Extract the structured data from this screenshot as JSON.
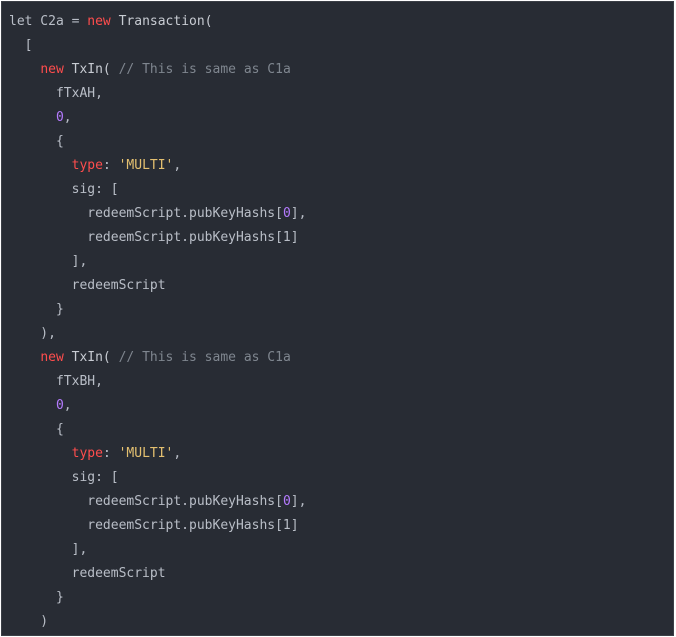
{
  "code": {
    "lines": [
      [
        {
          "t": "let C2a = ",
          "c": "ident"
        },
        {
          "t": "new",
          "c": "kw"
        },
        {
          "t": " Transaction(",
          "c": "fn"
        }
      ],
      [
        {
          "t": "  [",
          "c": "punc"
        }
      ],
      [
        {
          "t": "    ",
          "c": "punc"
        },
        {
          "t": "new",
          "c": "kw"
        },
        {
          "t": " TxIn( ",
          "c": "fn"
        },
        {
          "t": "// This is same as C1a",
          "c": "cm"
        }
      ],
      [
        {
          "t": "      fTxAH,",
          "c": "ident"
        }
      ],
      [
        {
          "t": "      ",
          "c": "punc"
        },
        {
          "t": "0",
          "c": "num"
        },
        {
          "t": ",",
          "c": "punc"
        }
      ],
      [
        {
          "t": "      {",
          "c": "punc"
        }
      ],
      [
        {
          "t": "        ",
          "c": "punc"
        },
        {
          "t": "type",
          "c": "prop"
        },
        {
          "t": ": ",
          "c": "punc"
        },
        {
          "t": "'MULTI'",
          "c": "str"
        },
        {
          "t": ",",
          "c": "punc"
        }
      ],
      [
        {
          "t": "        sig: [",
          "c": "ident"
        }
      ],
      [
        {
          "t": "          redeemScript.pubKeyHashs[",
          "c": "ident"
        },
        {
          "t": "0",
          "c": "num"
        },
        {
          "t": "],",
          "c": "ident"
        }
      ],
      [
        {
          "t": "          redeemScript.pubKeyHashs[1]",
          "c": "ident"
        }
      ],
      [
        {
          "t": "        ],",
          "c": "punc"
        }
      ],
      [
        {
          "t": "        redeemScript",
          "c": "ident"
        }
      ],
      [
        {
          "t": "      }",
          "c": "punc"
        }
      ],
      [
        {
          "t": "    ),",
          "c": "punc"
        }
      ],
      [
        {
          "t": "    ",
          "c": "punc"
        },
        {
          "t": "new",
          "c": "kw"
        },
        {
          "t": " TxIn( ",
          "c": "fn"
        },
        {
          "t": "// This is same as C1a",
          "c": "cm"
        }
      ],
      [
        {
          "t": "      fTxBH,",
          "c": "ident"
        }
      ],
      [
        {
          "t": "      ",
          "c": "punc"
        },
        {
          "t": "0",
          "c": "num"
        },
        {
          "t": ",",
          "c": "punc"
        }
      ],
      [
        {
          "t": "      {",
          "c": "punc"
        }
      ],
      [
        {
          "t": "        ",
          "c": "punc"
        },
        {
          "t": "type",
          "c": "prop"
        },
        {
          "t": ": ",
          "c": "punc"
        },
        {
          "t": "'MULTI'",
          "c": "str"
        },
        {
          "t": ",",
          "c": "punc"
        }
      ],
      [
        {
          "t": "        sig: [",
          "c": "ident"
        }
      ],
      [
        {
          "t": "          redeemScript.pubKeyHashs[",
          "c": "ident"
        },
        {
          "t": "0",
          "c": "num"
        },
        {
          "t": "],",
          "c": "ident"
        }
      ],
      [
        {
          "t": "          redeemScript.pubKeyHashs[1]",
          "c": "ident"
        }
      ],
      [
        {
          "t": "        ],",
          "c": "punc"
        }
      ],
      [
        {
          "t": "        redeemScript",
          "c": "ident"
        }
      ],
      [
        {
          "t": "      }",
          "c": "punc"
        }
      ],
      [
        {
          "t": "    )",
          "c": "punc"
        }
      ]
    ]
  }
}
